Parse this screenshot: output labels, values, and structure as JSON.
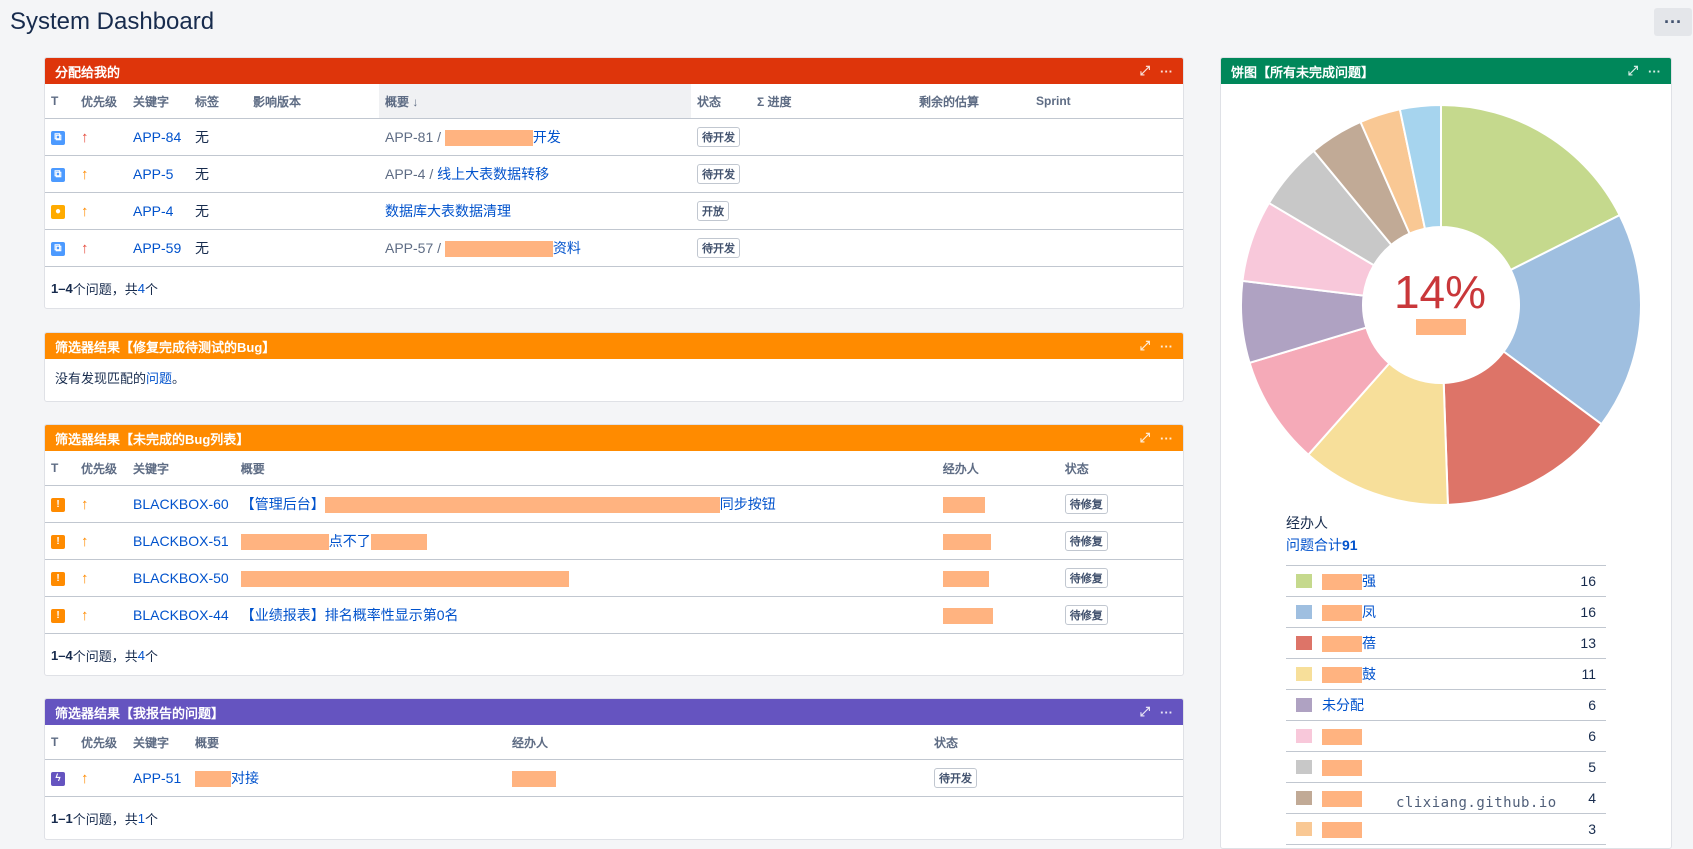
{
  "page": {
    "title": "System Dashboard",
    "more_label": "···"
  },
  "colors": {
    "assigned": "#de350b",
    "filter_bug_fixed": "#ff8b00",
    "filter_bug_open": "#ff8b00",
    "reported": "#6554c0",
    "pie": "#00875a"
  },
  "gadget_assigned": {
    "title": "分配给我的",
    "columns": [
      "T",
      "优先级",
      "关键字",
      "标签",
      "影响版本",
      "概要 ↓",
      "状态",
      "Σ 进度",
      "剩余的估算",
      "Sprint"
    ],
    "rows": [
      {
        "type": "sub-task-icon",
        "priority": "highest-arrow-icon",
        "key": "APP-84",
        "labels": "无",
        "parent": "APP-81 /",
        "summary": "开发",
        "status": "待开发"
      },
      {
        "type": "sub-task-icon",
        "priority": "high-arrow-icon",
        "key": "APP-5",
        "labels": "无",
        "parent": "APP-4 /",
        "summary": "线上大表数据转移",
        "status": "待开发"
      },
      {
        "type": "improvement-icon",
        "priority": "high-arrow-icon",
        "key": "APP-4",
        "labels": "无",
        "parent": "",
        "summary": "数据库大表数据清理",
        "status": "开放"
      },
      {
        "type": "sub-task-icon",
        "priority": "highest-arrow-icon",
        "key": "APP-59",
        "labels": "无",
        "parent": "APP-57 /",
        "summary": "资料",
        "status": "待开发"
      }
    ],
    "footer": {
      "range": "1–4",
      "mid": " 个问题，共 ",
      "total": "4",
      "tail": " 个"
    }
  },
  "gadget_fixed": {
    "title": "筛选器结果【修复完成待测试的Bug】",
    "message_prefix": "没有发现匹配的",
    "message_link": "问题",
    "message_suffix": "。"
  },
  "gadget_open_bugs": {
    "title": "筛选器结果【未完成的Bug列表】",
    "columns": [
      "T",
      "优先级",
      "关键字",
      "概要",
      "经办人",
      "状态"
    ],
    "rows": [
      {
        "key": "BLACKBOX-60",
        "summary_prefix": "【管理后台】",
        "summary_suffix": "同步按钮",
        "status": "待修复"
      },
      {
        "key": "BLACKBOX-51",
        "summary_prefix": "",
        "summary_suffix": "点不了",
        "status": "待修复"
      },
      {
        "key": "BLACKBOX-50",
        "summary_prefix": "",
        "summary_suffix": "",
        "status": "待修复"
      },
      {
        "key": "BLACKBOX-44",
        "summary_prefix": "【业绩报表】排名概率性显示第0名",
        "summary_suffix": "",
        "status": "待修复"
      }
    ],
    "footer": {
      "range": "1–4",
      "mid": " 个问题，共 ",
      "total": "4",
      "tail": " 个"
    }
  },
  "gadget_reported": {
    "title": "筛选器结果【我报告的问题】",
    "columns": [
      "T",
      "优先级",
      "关键字",
      "概要",
      "经办人",
      "状态"
    ],
    "rows": [
      {
        "key": "APP-51",
        "summary": "对接",
        "status": "待开发"
      }
    ],
    "footer": {
      "range": "1–1",
      "mid": " 个问题，共 ",
      "total": "1",
      "tail": " 个"
    }
  },
  "gadget_pie": {
    "title": "饼图【所有未完成问题】",
    "center_value": "14%",
    "legend_title": "经办人",
    "total_label": "问题合计",
    "total_value": "91"
  },
  "chart_data": {
    "type": "pie",
    "title": "",
    "total": 91,
    "series": [
      {
        "name": "强",
        "value": 16,
        "color": "#c5d98d"
      },
      {
        "name": "凤",
        "value": 16,
        "color": "#9fbfe0"
      },
      {
        "name": "蓓",
        "value": 13,
        "color": "#dd7468"
      },
      {
        "name": "鼓",
        "value": 11,
        "color": "#f7df9a"
      },
      {
        "name": "",
        "value": 8,
        "color": "#f5aab8"
      },
      {
        "name": "未分配",
        "value": 6,
        "color": "#afa2c2"
      },
      {
        "name": "",
        "value": 6,
        "color": "#f8c8da"
      },
      {
        "name": "",
        "value": 5,
        "color": "#c8c8c8"
      },
      {
        "name": "",
        "value": 4,
        "color": "#c1aa96"
      },
      {
        "name": "",
        "value": 3,
        "color": "#f9c894"
      },
      {
        "name": "",
        "value": 3,
        "color": "#a6d4ee"
      }
    ],
    "legend_rows_visible": 9,
    "legend_counts_visible": [
      16,
      16,
      13,
      11,
      6,
      6,
      5,
      4,
      3
    ]
  },
  "watermark": "clixiang.github.io"
}
